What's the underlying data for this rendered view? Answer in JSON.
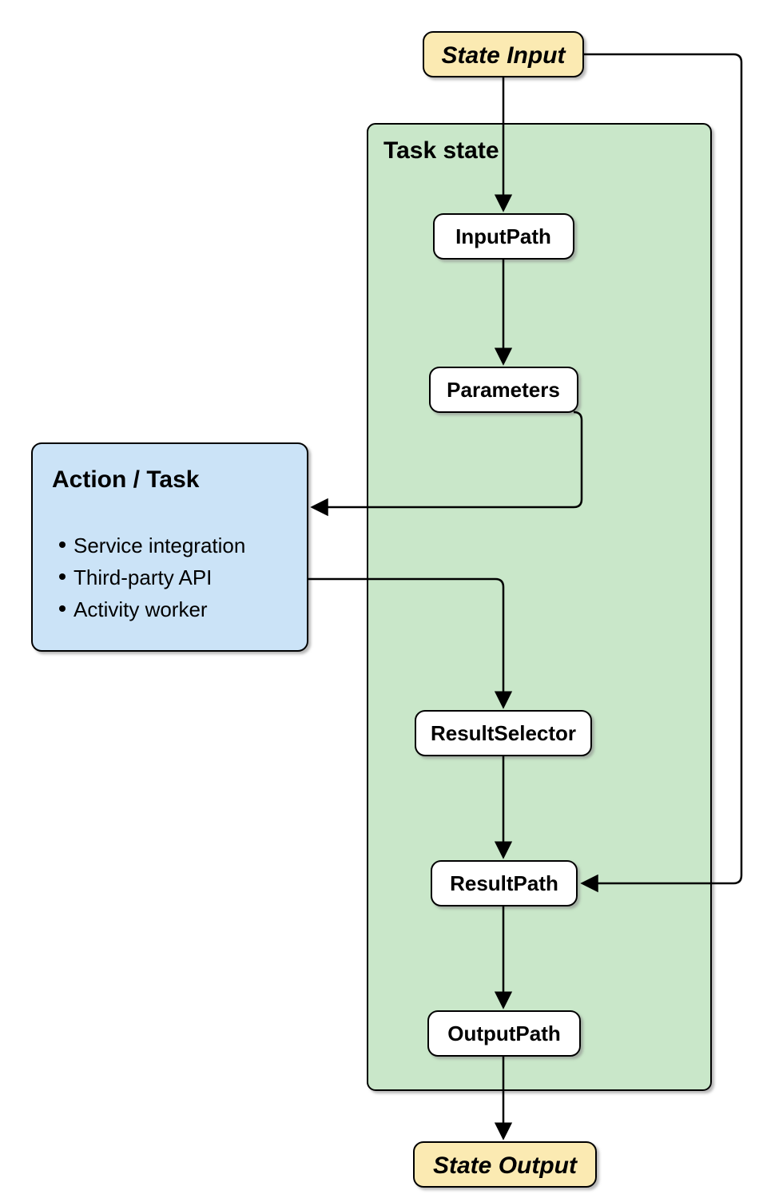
{
  "diagram": {
    "stateInput": "State Input",
    "stateOutput": "State Output",
    "taskStateTitle": "Task state",
    "steps": {
      "inputPath": "InputPath",
      "parameters": "Parameters",
      "resultSelector": "ResultSelector",
      "resultPath": "ResultPath",
      "outputPath": "OutputPath"
    },
    "actionTask": {
      "title": "Action / Task",
      "bullets": [
        "Service integration",
        "Third-party API",
        "Activity worker"
      ]
    }
  }
}
